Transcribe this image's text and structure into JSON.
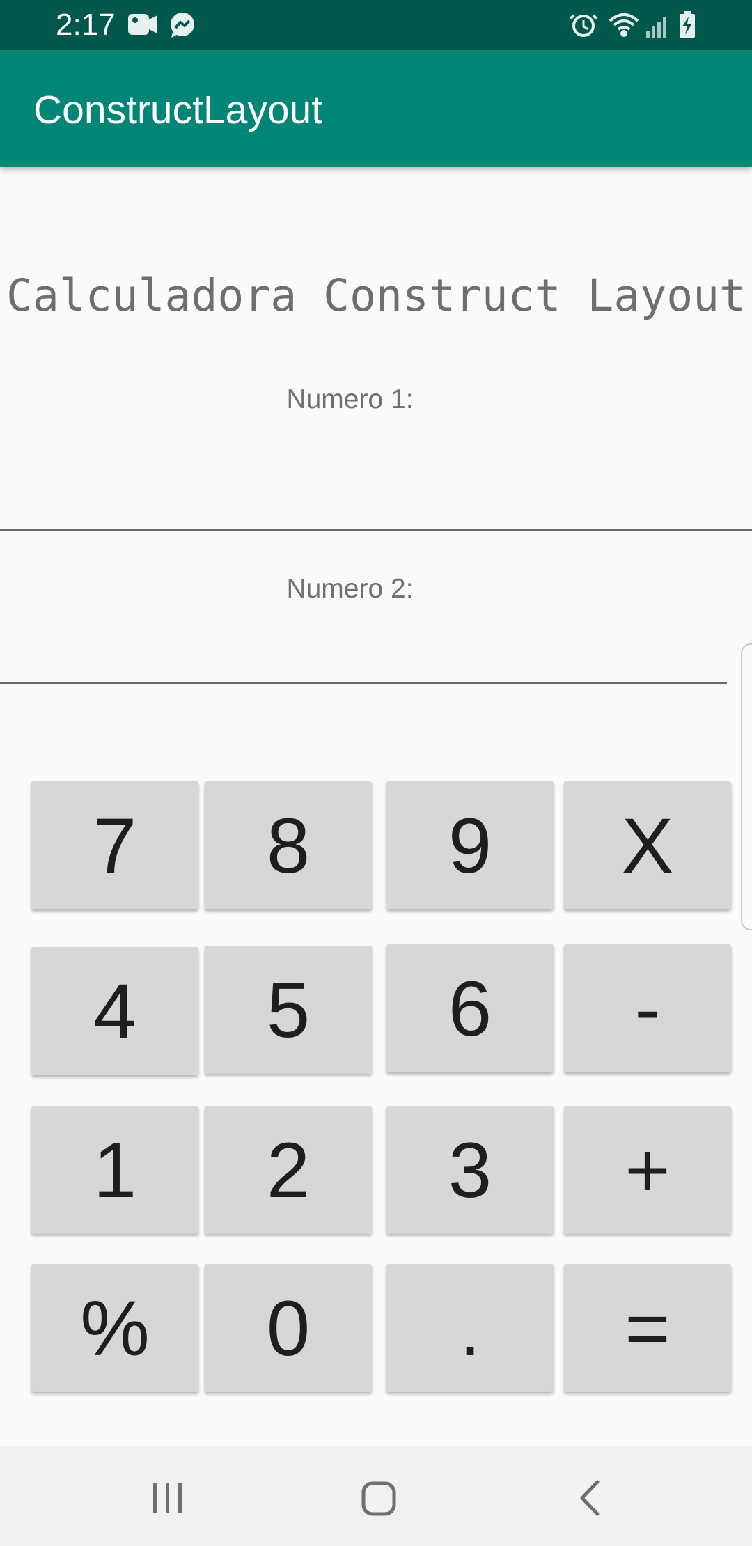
{
  "status_bar": {
    "time": "2:17",
    "left_icons": [
      "video-camera-icon",
      "messenger-icon"
    ],
    "right_icons": [
      "alarm-icon",
      "wifi-icon",
      "signal-icon",
      "battery-charging-icon"
    ]
  },
  "app_bar": {
    "title": "ConstructLayout"
  },
  "main": {
    "heading": "Calculadora Construct Layout",
    "number1": {
      "label": "Numero 1:",
      "value": "",
      "placeholder": ""
    },
    "number2": {
      "label": "Numero 2:",
      "value": "",
      "placeholder": ""
    }
  },
  "keypad": {
    "rows": [
      [
        "7",
        "8",
        "9",
        "X"
      ],
      [
        "4",
        "5",
        "6",
        "-"
      ],
      [
        "1",
        "2",
        "3",
        "+"
      ],
      [
        "%",
        "0",
        ".",
        "="
      ]
    ]
  },
  "nav_bar": {
    "buttons": [
      "recent-apps-icon",
      "home-icon",
      "back-icon"
    ]
  },
  "colors": {
    "status_bar": "#00574b",
    "app_bar": "#008577",
    "key_background": "#d6d7d7",
    "background": "#fafafa"
  }
}
